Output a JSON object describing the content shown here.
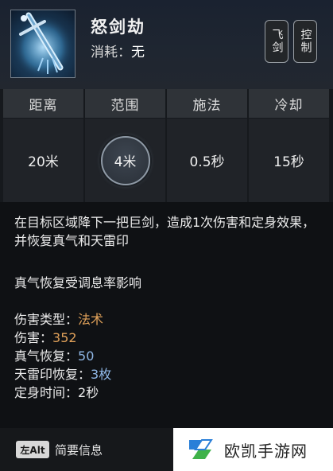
{
  "skill": {
    "name": "怒剑劫",
    "cost_label": "消耗：",
    "cost_value": "无",
    "tags": [
      "飞剑",
      "控制"
    ]
  },
  "stats": [
    {
      "header": "距离",
      "value": "20米"
    },
    {
      "header": "范围",
      "value": "4米"
    },
    {
      "header": "施法",
      "value": "0.5秒"
    },
    {
      "header": "冷却",
      "value": "15秒"
    }
  ],
  "description": {
    "main": "在目标区域降下一把巨剑，造成1次伤害和定身效果，并恢复真气和天雷印",
    "note": "真气恢复受调息率影响",
    "properties": [
      {
        "label": "伤害类型：",
        "value": "法术",
        "color": "#e0a15a"
      },
      {
        "label": "伤害：",
        "value": "352",
        "color": "#e0a15a"
      },
      {
        "label": "真气恢复：",
        "value": "50",
        "color": "#8fb7e6"
      },
      {
        "label": "天雷印恢复：",
        "value": "3枚",
        "color": "#8fb7e6"
      },
      {
        "label": "定身时间：",
        "value": "2秒",
        "color": "#ececec"
      }
    ]
  },
  "footer": {
    "key": "左Alt",
    "label": "简要信息"
  },
  "watermark": {
    "text": "欧凯手游网"
  }
}
